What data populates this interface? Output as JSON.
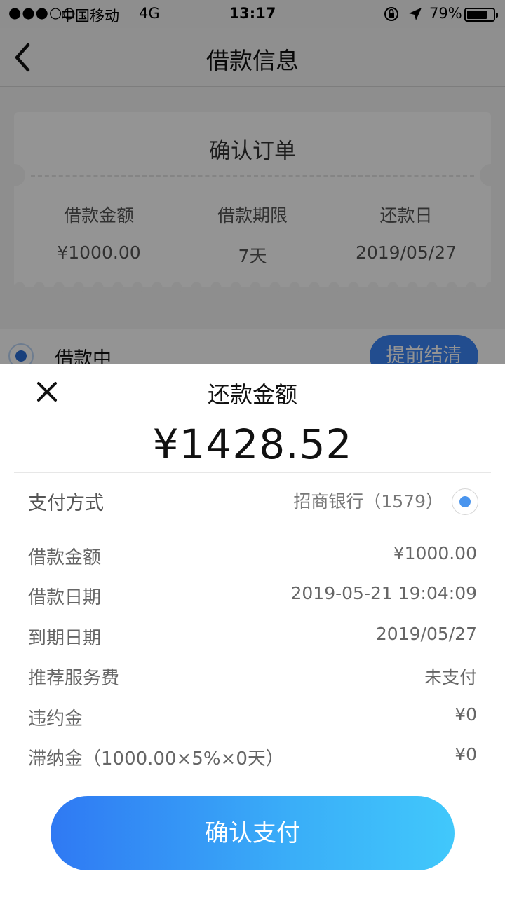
{
  "status_bar": {
    "signal": "●●●○○",
    "carrier": "中国移动",
    "network": "4G",
    "time": "13:17",
    "battery_percent": "79%",
    "battery_level": 0.79,
    "icons": [
      "orientation-lock-icon",
      "location-arrow-icon",
      "battery-icon"
    ]
  },
  "nav": {
    "title": "借款信息",
    "back_icon": "chevron-left-icon"
  },
  "order_card": {
    "title": "确认订单",
    "columns": [
      {
        "label": "借款金额",
        "value": "¥1000.00"
      },
      {
        "label": "借款期限",
        "value": "7天"
      },
      {
        "label": "还款日",
        "value": "2019/05/27"
      }
    ]
  },
  "loan_status": {
    "text": "借款中",
    "prepay_button": "提前结清"
  },
  "sheet": {
    "title": "还款金额",
    "close_icon": "close-icon",
    "amount": "¥1428.52",
    "payment": {
      "label": "支付方式",
      "bank": "招商银行（1579）",
      "selected": true
    },
    "details": [
      {
        "label": "借款金额",
        "value": "¥1000.00"
      },
      {
        "label": "借款日期",
        "value": "2019-05-21 19:04:09"
      },
      {
        "label": "到期日期",
        "value": "2019/05/27"
      },
      {
        "label": "推荐服务费",
        "value": "未支付"
      },
      {
        "label": "违约金",
        "value": "¥0"
      },
      {
        "label": "滞纳金（1000.00×5%×0天）",
        "value": "¥0"
      }
    ],
    "confirm_button": "确认支付"
  },
  "colors": {
    "accent": "#3b86f6",
    "gradient_start": "#2f79f3",
    "gradient_end": "#41c8fb",
    "radio": "#4a95ee"
  }
}
